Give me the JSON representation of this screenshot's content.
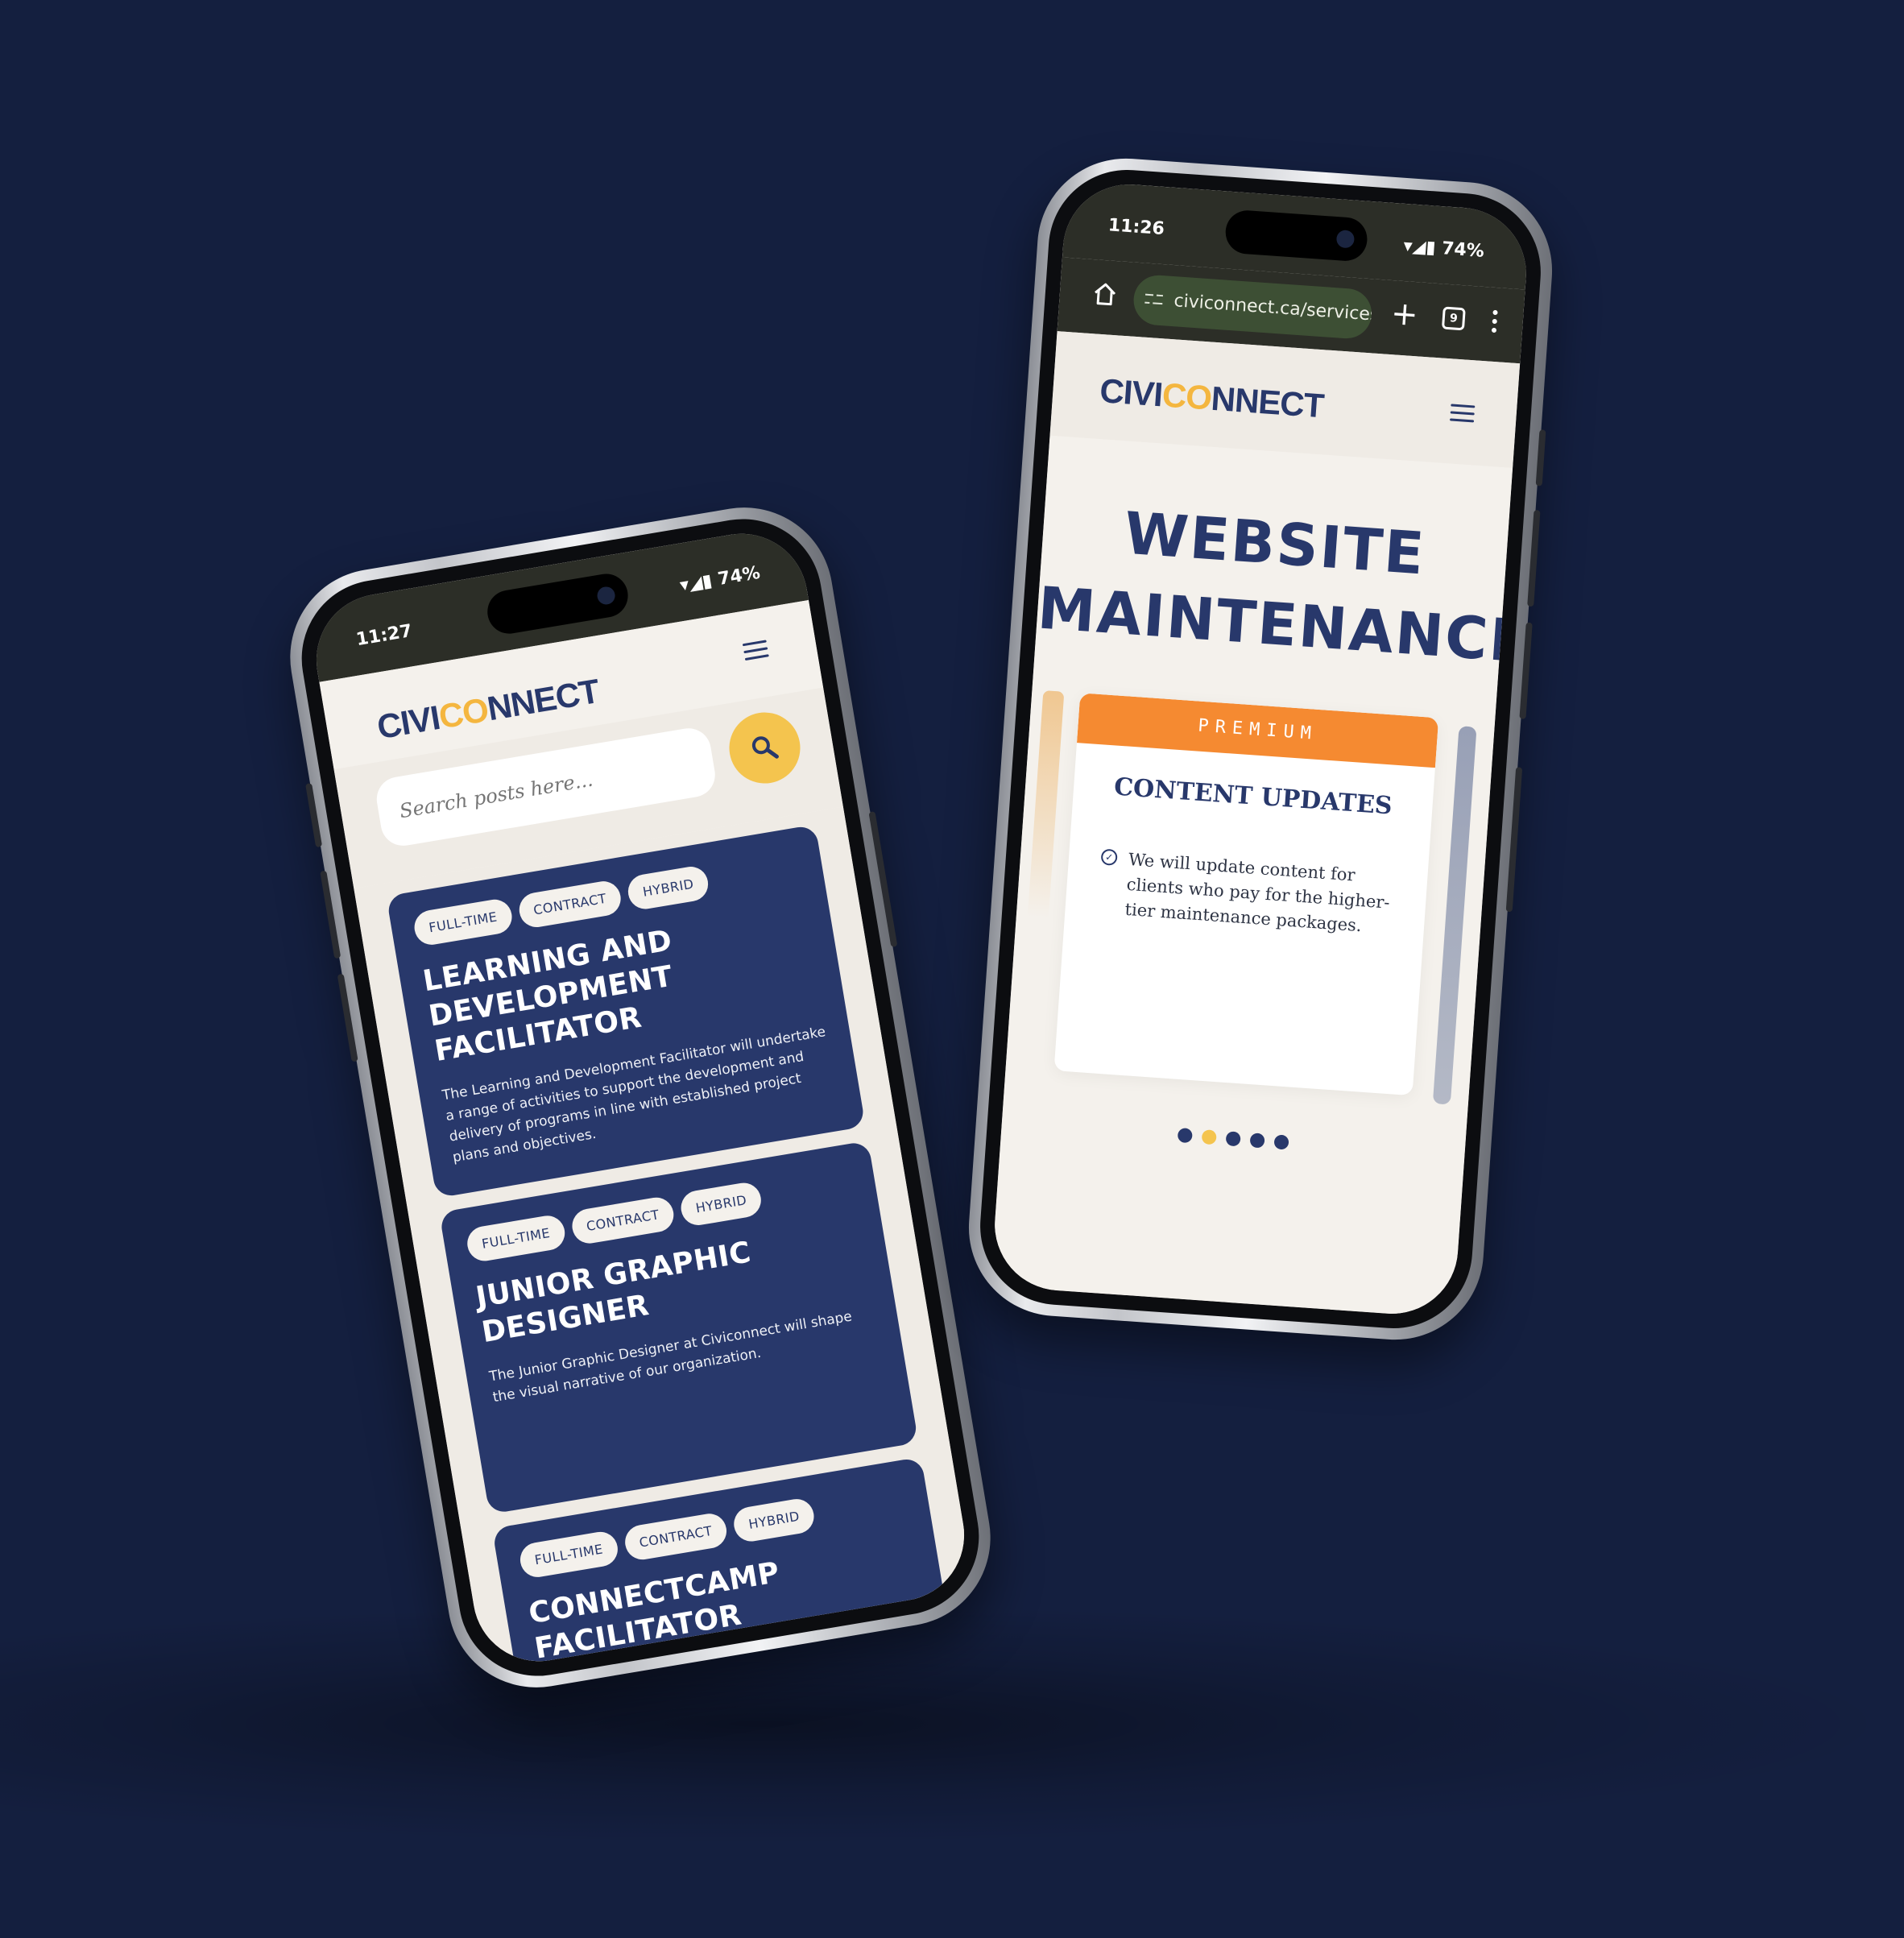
{
  "left_phone": {
    "status": {
      "time": "11:27",
      "battery": "74%"
    },
    "logo": {
      "pre": "CIVI",
      "o": "CO",
      "post": "NNECT"
    },
    "search": {
      "placeholder": "Search posts here..."
    },
    "jobs": [
      {
        "tags": [
          "FULL-TIME",
          "CONTRACT",
          "HYBRID"
        ],
        "title": "LEARNING AND DEVELOPMENT FACILITATOR",
        "description": "The Learning and Development Facilitator will undertake a range of activities to support the development and delivery of programs in line with established project plans and objectives."
      },
      {
        "tags": [
          "FULL-TIME",
          "CONTRACT",
          "HYBRID"
        ],
        "title": "JUNIOR GRAPHIC DESIGNER",
        "description": "The Junior Graphic Designer at Civiconnect will shape the visual narrative of our organization."
      },
      {
        "tags": [
          "FULL-TIME",
          "CONTRACT",
          "HYBRID"
        ],
        "title": "CONNECTCAMP FACILITATOR",
        "description": ""
      }
    ]
  },
  "right_phone": {
    "status": {
      "time": "11:26",
      "battery": "74%"
    },
    "browser": {
      "url": "civiconnect.ca/services/",
      "tab_count": "9"
    },
    "logo": {
      "pre": "CIVI",
      "o": "CO",
      "post": "NNECT"
    },
    "page_title_line1": "WEBSITE",
    "page_title_line2": "MAINTENANCE",
    "plan": {
      "tier": "PREMIUM",
      "title": "CONTENT UPDATES",
      "feature": "We will update content for clients who pay for the higher-tier maintenance packages."
    },
    "carousel": {
      "count": 5,
      "active_index": 1
    }
  },
  "colors": {
    "background": "#141f3f",
    "brand_navy": "#28386b",
    "brand_yellow": "#f4c44e",
    "accent_orange": "#f58a31"
  }
}
